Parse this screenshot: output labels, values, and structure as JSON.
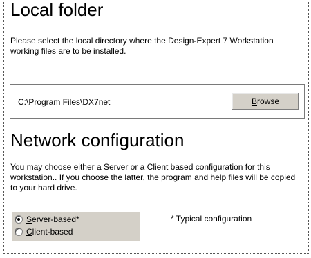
{
  "local_folder": {
    "heading": "Local folder",
    "description": "Please select the local directory where the Design-Expert 7 Workstation working files are to be installed.",
    "path_value": "C:\\Program Files\\DX7net",
    "browse_button": {
      "accel": "B",
      "rest": "rowse"
    }
  },
  "network_configuration": {
    "heading": "Network configuration",
    "description": "You may choose either a Server or a Client based configuration for this workstation..  If you choose the latter, the program and help files will be copied to your hard drive.",
    "options": [
      {
        "accel": "S",
        "rest": "erver-based*",
        "checked": true
      },
      {
        "accel": "C",
        "rest": "lient-based",
        "checked": false
      }
    ],
    "note": "* Typical configuration"
  }
}
